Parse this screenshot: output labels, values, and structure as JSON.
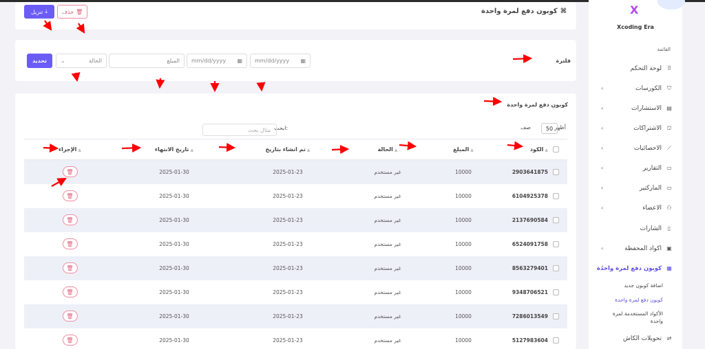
{
  "header": {
    "title": "كوبون دفع لمرة واحدة",
    "title_icon": "command-icon",
    "download_label": "تنزيل",
    "delete_label": "حذف"
  },
  "filter": {
    "title": "فلترة",
    "date_from_placeholder": "mm/dd/yyyy",
    "date_to_placeholder": "mm/dd/yyyy",
    "amount_placeholder": "المبلغ",
    "status_label": "الحالة",
    "submit_label": "تحديد"
  },
  "table": {
    "title": "كوبون دفع لمرة واحدة",
    "show_label": "أظهر",
    "entries_label": "صف",
    "per_page": "50",
    "search_label": "ابحث:",
    "search_placeholder": "مثال بحث",
    "columns": [
      "الكود",
      "المبلغ",
      "الحالة",
      "تم انشاء بتاريخ",
      "تاريخ الانتهاء",
      "الإجراء"
    ],
    "rows": [
      {
        "code": "2903641875",
        "amount": "10000",
        "status": "غير مستخدم",
        "created": "2025-01-23",
        "expires": "2025-01-30"
      },
      {
        "code": "6104925378",
        "amount": "10000",
        "status": "غير مستخدم",
        "created": "2025-01-23",
        "expires": "2025-01-30"
      },
      {
        "code": "2137690584",
        "amount": "10000",
        "status": "غير مستخدم",
        "created": "2025-01-23",
        "expires": "2025-01-30"
      },
      {
        "code": "6524091758",
        "amount": "10000",
        "status": "غير مستخدم",
        "created": "2025-01-23",
        "expires": "2025-01-30"
      },
      {
        "code": "8563279401",
        "amount": "10000",
        "status": "غير مستخدم",
        "created": "2025-01-23",
        "expires": "2025-01-30"
      },
      {
        "code": "9348706521",
        "amount": "10000",
        "status": "غير مستخدم",
        "created": "2025-01-23",
        "expires": "2025-01-30"
      },
      {
        "code": "7286013549",
        "amount": "10000",
        "status": "غير مستخدم",
        "created": "2025-01-23",
        "expires": "2025-01-30"
      },
      {
        "code": "5127983604",
        "amount": "10000",
        "status": "غير مستخدم",
        "created": "2025-01-23",
        "expires": "2025-01-30"
      }
    ]
  },
  "sidebar": {
    "brand": "Xcoding Era",
    "menu_heading": "القائمة",
    "items": [
      {
        "label": "لوحة التحكم",
        "icon": "grid-icon",
        "chevron": false
      },
      {
        "label": "الكورسات",
        "icon": "basket-icon",
        "chevron": true
      },
      {
        "label": "الاستشارات",
        "icon": "document-icon",
        "chevron": true
      },
      {
        "label": "الاشتراكات",
        "icon": "hierarchy-icon",
        "chevron": true
      },
      {
        "label": "الاحصائيات",
        "icon": "trend-icon",
        "chevron": true
      },
      {
        "label": "التقارير",
        "icon": "archive-icon",
        "chevron": true
      },
      {
        "label": "الماركتير",
        "icon": "archive-icon",
        "chevron": true
      },
      {
        "label": "الاعضاء",
        "icon": "users-icon",
        "chevron": true
      },
      {
        "label": "الشارات",
        "icon": "badge-icon",
        "chevron": false
      },
      {
        "label": "اكواد المحفظة",
        "icon": "wallet-icon",
        "chevron": true
      },
      {
        "label": "كوبون دفع لمرة واحدة",
        "icon": "coupon-icon",
        "chevron": true,
        "active": true
      }
    ],
    "subitems": [
      {
        "label": "اضافة كوبون جديد"
      },
      {
        "label": "كوبون دفع لمرة واحدة",
        "current": true
      },
      {
        "label": "الأكواد المستخدمة لمرة واحدة"
      }
    ],
    "last_item": {
      "label": "تحويلات الكاش",
      "icon": "transfer-icon"
    }
  },
  "colors": {
    "primary": "#6b5cf6",
    "danger": "#e35d7a",
    "annotation_arrow": "#ff0000"
  }
}
